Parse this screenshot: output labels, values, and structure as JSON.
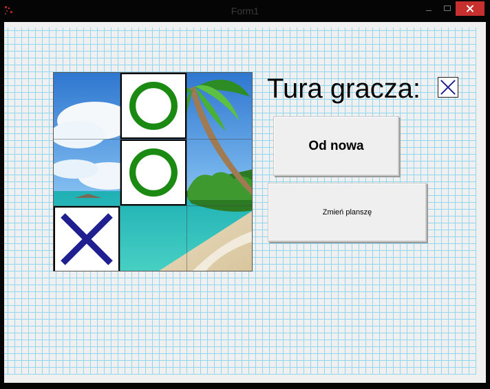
{
  "window": {
    "title": "Form1"
  },
  "board": {
    "cells": [
      {
        "mark": "",
        "filled": false
      },
      {
        "mark": "O",
        "filled": true
      },
      {
        "mark": "",
        "filled": false
      },
      {
        "mark": "",
        "filled": false
      },
      {
        "mark": "O",
        "filled": true
      },
      {
        "mark": "",
        "filled": false
      },
      {
        "mark": "X",
        "filled": true
      },
      {
        "mark": "",
        "filled": false
      },
      {
        "mark": "",
        "filled": false
      }
    ],
    "o_color": "#1a8a12",
    "x_color": "#1f1f8f"
  },
  "turn": {
    "label": "Tura gracza:",
    "current_mark": "X"
  },
  "buttons": {
    "new_game": "Od nowa",
    "change_board": "Zmień planszę"
  },
  "colors": {
    "grid": "#8ed7ee",
    "close_button": "#c6302e"
  }
}
